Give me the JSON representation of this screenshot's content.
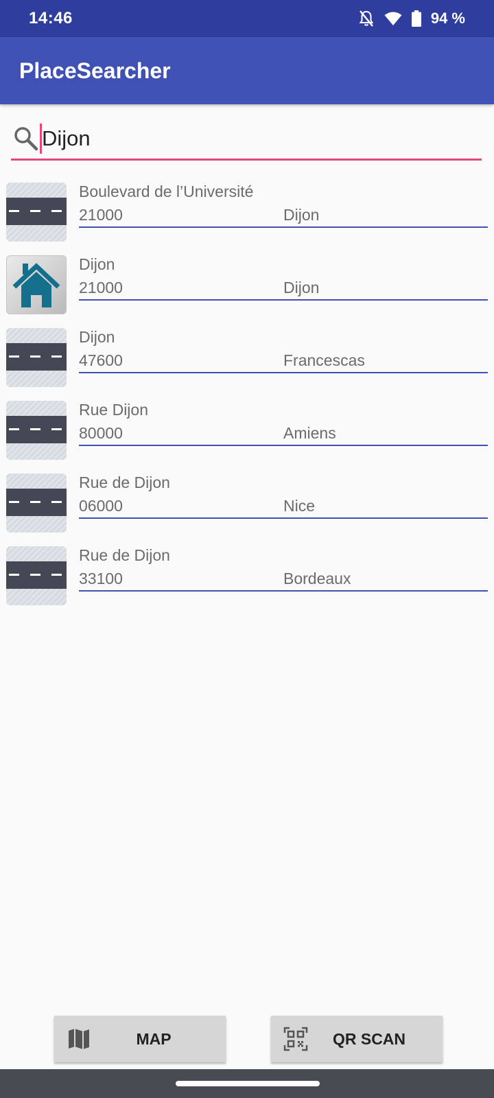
{
  "status_bar": {
    "time": "14:46",
    "battery": "94 %",
    "icons": [
      "notifications-off-icon",
      "wifi-icon",
      "battery-icon"
    ]
  },
  "app_bar": {
    "title": "PlaceSearcher"
  },
  "search": {
    "value": "Dijon",
    "icon": "search-icon"
  },
  "results": [
    {
      "name": "Boulevard de l’Université",
      "zip": "21000",
      "city": "Dijon",
      "icon": "road-icon"
    },
    {
      "name": "Dijon",
      "zip": "21000",
      "city": "Dijon",
      "icon": "home-icon"
    },
    {
      "name": "Dijon",
      "zip": "47600",
      "city": "Francescas",
      "icon": "road-icon"
    },
    {
      "name": "Rue Dijon",
      "zip": "80000",
      "city": "Amiens",
      "icon": "road-icon"
    },
    {
      "name": "Rue de Dijon",
      "zip": "06000",
      "city": "Nice",
      "icon": "road-icon"
    },
    {
      "name": "Rue de Dijon",
      "zip": "33100",
      "city": "Bordeaux",
      "icon": "road-icon"
    }
  ],
  "buttons": {
    "map": {
      "label": "MAP",
      "icon": "map-icon"
    },
    "qr_scan": {
      "label": "QR SCAN",
      "icon": "qr-code-icon"
    }
  },
  "colors": {
    "status_bar": "#2f3e9e",
    "app_bar": "#3f51b5",
    "accent": "#e8457c",
    "divider": "#3f51b5"
  }
}
